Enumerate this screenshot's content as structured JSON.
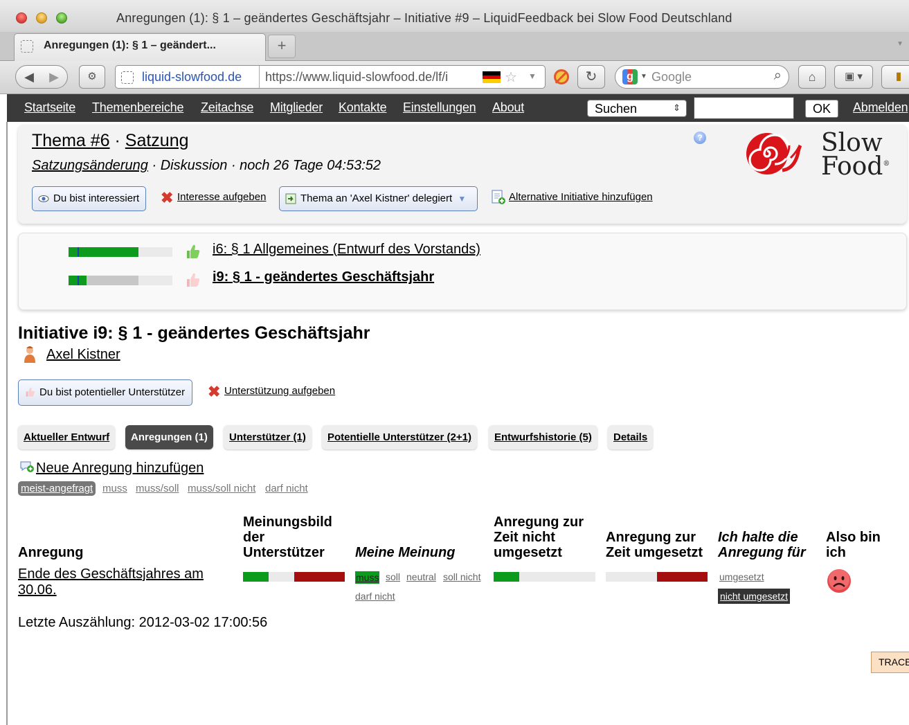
{
  "window": {
    "title": "Anregungen (1): § 1 – geändertes Geschäftsjahr – Initiative #9 – LiquidFeedback bei Slow Food Deutschland"
  },
  "browser": {
    "tab_title": "Anregungen (1): § 1 – geändert...",
    "new_tab": "+",
    "url_domain": "liquid-slowfood.de",
    "url": "https://www.liquid-slowfood.de/lf/i",
    "search_engine": "Google",
    "icons": [
      "back-icon",
      "forward-icon",
      "identity-icon",
      "star-icon",
      "block-icon",
      "reload-icon",
      "google-icon",
      "search-icon",
      "home-icon",
      "bookmark-icon",
      "extension-icon"
    ]
  },
  "nav": {
    "links": [
      "Startseite",
      "Themenbereiche",
      "Zeitachse",
      "Mitglieder",
      "Kontakte",
      "Einstellungen",
      "About"
    ],
    "search_select": "Suchen",
    "search_value": "",
    "ok": "OK",
    "logout": "Abmelden"
  },
  "topic": {
    "title_link": "Thema #6",
    "title_sep": " · ",
    "area_link": "Satzung",
    "policy_link": "Satzungsänderung",
    "state": " · Diskussion · noch 26 Tage 04:53:52",
    "interested": "Du bist interessiert",
    "remove_interest": "Interesse aufgeben",
    "delegation": "Thema an 'Axel Kistner' delegiert",
    "add_alternative": "Alternative Initiative hinzufügen",
    "help": "?",
    "logo_line1": "Slow",
    "logo_line2": "Food",
    "logo_mark": "®"
  },
  "versions": [
    {
      "label": "i6: § 1 Allgemeines (Entwurf des Vorstands)",
      "support": 0.67,
      "potential": 0.0,
      "thumb": "thumb-up-green-icon",
      "bold": false
    },
    {
      "label": "i9: § 1 - geändertes Geschäftsjahr",
      "support": 0.17,
      "potential": 0.5,
      "thumb": "thumb-up-pink-icon",
      "bold": true
    }
  ],
  "initiative": {
    "title": "Initiative i9: § 1 - geändertes Geschäftsjahr",
    "author": "Axel Kistner",
    "potential_supporter": "Du bist potentieller Unterstützer",
    "remove_support": "Unterstützung aufgeben"
  },
  "tabs": [
    {
      "label": "Aktueller Entwurf",
      "active": false
    },
    {
      "label": "Anregungen (1)",
      "active": true
    },
    {
      "label": "Unterstützer (1)",
      "active": false
    },
    {
      "label": "Potentielle Unterstützer (2+1)",
      "active": false
    },
    {
      "label": "Entwurfshistorie (5)",
      "active": false
    },
    {
      "label": "Details",
      "active": false
    }
  ],
  "suggestions": {
    "new_label": "Neue Anregung hinzufügen",
    "filters": [
      "meist-angefragt",
      "muss",
      "muss/soll",
      "muss/soll nicht",
      "darf nicht"
    ],
    "active_filter": "meist-angefragt",
    "headers": {
      "anregung": "Anregung",
      "meinungsbild": "Meinungsbild der Unterstützer",
      "meine_meinung": "Meine Meinung",
      "nicht_umgesetzt": "Anregung zur Zeit nicht umgesetzt",
      "umgesetzt": "Anregung zur Zeit umgesetzt",
      "ich_halte": "Ich halte die Anregung für",
      "also_bin": "Also bin ich"
    },
    "rows": [
      {
        "title": "Ende des Geschäftsjahres am 30.06.",
        "opinion": {
          "muss": 0.25,
          "soll": 0.0,
          "neutral": 0.25,
          "soll_nicht": 0.0,
          "darf_nicht": 0.5
        },
        "my_options": [
          "muss",
          "soll",
          "neutral",
          "soll nicht",
          "darf nicht"
        ],
        "my_selected": "muss",
        "not_implemented_share": 0.25,
        "implemented_share": 0.5,
        "fulfilled_options": [
          "umgesetzt",
          "nicht umgesetzt"
        ],
        "fulfilled_selected": "nicht umgesetzt",
        "mood_icon": "sad-face-icon"
      }
    ]
  },
  "footer": {
    "last_count": "Letzte Auszählung: 2012-03-02 17:00:56",
    "trace": "TRACE"
  },
  "colors": {
    "green": "#0c9b1c",
    "red": "#a50e0e",
    "blue": "#1a3fb0",
    "nav_bg": "#3a3a3a"
  }
}
